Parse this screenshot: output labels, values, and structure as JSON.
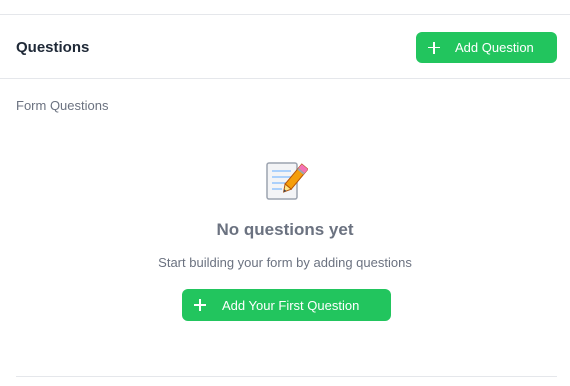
{
  "header": {
    "title": "Questions",
    "add_button_label": "Add Question"
  },
  "section": {
    "label": "Form Questions"
  },
  "empty_state": {
    "icon": "memo-pencil-icon",
    "title": "No questions yet",
    "subtitle": "Start building your form by adding questions",
    "button_label": "Add Your First Question"
  },
  "colors": {
    "accent": "#22c55e",
    "muted_text": "#6b7280",
    "divider": "#e5e7eb"
  }
}
